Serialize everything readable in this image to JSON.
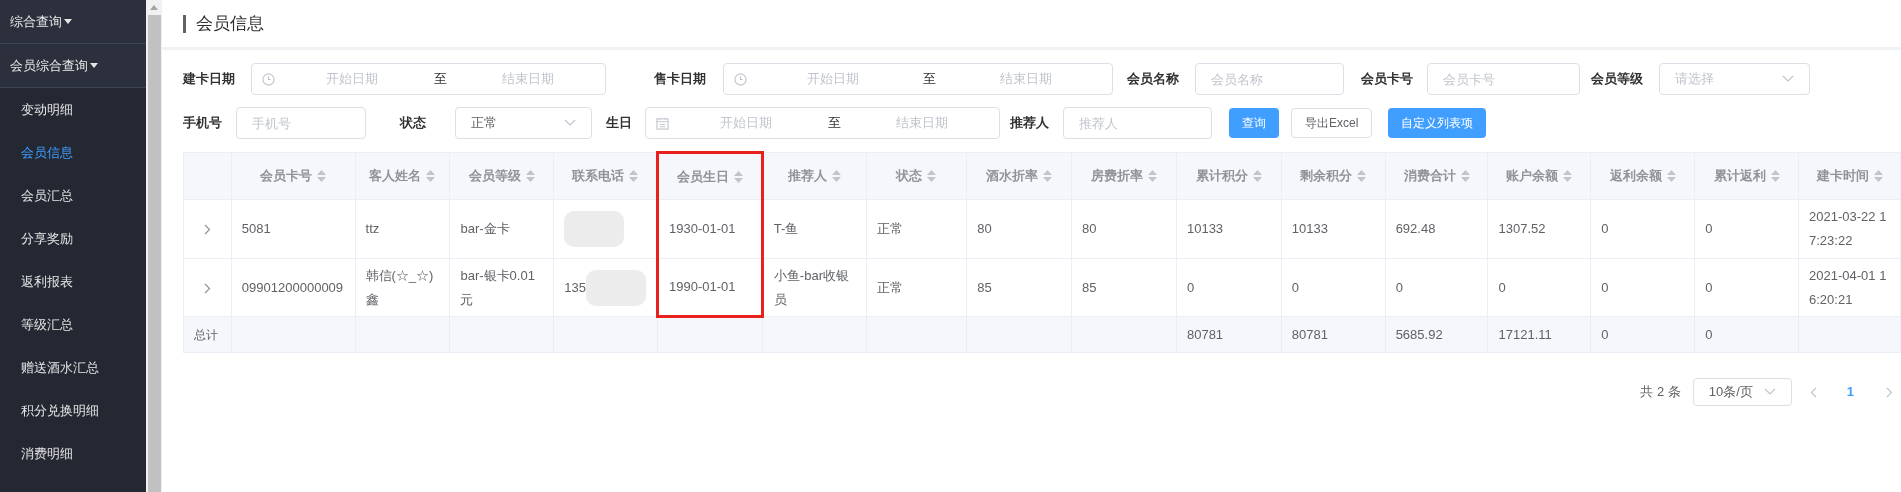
{
  "sidebar": {
    "groups": [
      {
        "label": "综合查询",
        "expanded": true
      },
      {
        "label": "会员综合查询",
        "expanded": true
      }
    ],
    "items": [
      {
        "label": "变动明细",
        "selected": false
      },
      {
        "label": "会员信息",
        "selected": true
      },
      {
        "label": "会员汇总",
        "selected": false
      },
      {
        "label": "分享奖励",
        "selected": false
      },
      {
        "label": "返利报表",
        "selected": false
      },
      {
        "label": "等级汇总",
        "selected": false
      },
      {
        "label": "赠送酒水汇总",
        "selected": false
      },
      {
        "label": "积分兑换明细",
        "selected": false
      },
      {
        "label": "消费明细",
        "selected": false
      }
    ]
  },
  "page_title": "会员信息",
  "filters": [
    [
      {
        "kind": "datetimerange",
        "label": "建卡日期",
        "start_placeholder": "开始日期",
        "separator": "至",
        "end_placeholder": "结束日期"
      },
      {
        "kind": "datetimerange",
        "label": "售卡日期",
        "start_placeholder": "开始日期",
        "separator": "至",
        "end_placeholder": "结束日期"
      },
      {
        "kind": "text",
        "label": "会员名称",
        "placeholder": "会员名称"
      },
      {
        "kind": "text",
        "label": "会员卡号",
        "placeholder": "会员卡号"
      },
      {
        "kind": "select",
        "label": "会员等级",
        "placeholder": "请选择"
      }
    ],
    [
      {
        "kind": "text",
        "label": "手机号",
        "placeholder": "手机号"
      },
      {
        "kind": "select",
        "label": "状态",
        "value": "正常"
      },
      {
        "kind": "daterange",
        "label": "生日",
        "start_placeholder": "开始日期",
        "separator": "至",
        "end_placeholder": "结束日期"
      },
      {
        "kind": "text",
        "label": "推荐人",
        "placeholder": "推荐人"
      }
    ]
  ],
  "buttons": [
    {
      "label": "查询",
      "kind": "primary"
    },
    {
      "label": "导出Excel",
      "kind": "default"
    },
    {
      "label": "自定义列表项",
      "kind": "primary"
    }
  ],
  "table": {
    "columns": [
      {
        "label": "会员卡号",
        "highlighted": false
      },
      {
        "label": "客人姓名",
        "highlighted": false
      },
      {
        "label": "会员等级",
        "highlighted": false
      },
      {
        "label": "联系电话",
        "highlighted": false
      },
      {
        "label": "会员生日",
        "highlighted": true
      },
      {
        "label": "推荐人",
        "highlighted": false
      },
      {
        "label": "状态",
        "highlighted": false
      },
      {
        "label": "酒水折率",
        "highlighted": false
      },
      {
        "label": "房费折率",
        "highlighted": false
      },
      {
        "label": "累计积分",
        "highlighted": false
      },
      {
        "label": "剩余积分",
        "highlighted": false
      },
      {
        "label": "消费合计",
        "highlighted": false
      },
      {
        "label": "账户余额",
        "highlighted": false
      },
      {
        "label": "返利余额",
        "highlighted": false
      },
      {
        "label": "累计返利",
        "highlighted": false
      },
      {
        "label": "建卡时间",
        "highlighted": false
      }
    ],
    "rows": [
      {
        "expanded": false,
        "cells": [
          "5081",
          "ttz",
          "bar-金卡",
          {
            "blurred": true
          },
          "1930-01-01",
          "T-鱼",
          "正常",
          "80",
          "80",
          "10133",
          "10133",
          "692.48",
          "1307.52",
          "0",
          "0",
          "2021-03-22 17:23:22"
        ]
      },
      {
        "expanded": false,
        "cells": [
          "09901200000009",
          "韩信(☆_☆)鑫",
          "bar-银卡0.01元",
          {
            "text": "135",
            "blurred": true
          },
          "1990-01-01",
          "小鱼-bar收银员",
          "正常",
          "85",
          "85",
          "0",
          "0",
          "0",
          "0",
          "0",
          "0",
          "2021-04-01 16:20:21"
        ]
      }
    ],
    "footer": {
      "label": "总计",
      "cells": [
        null,
        null,
        null,
        null,
        null,
        null,
        null,
        null,
        null,
        "80781",
        "80781",
        "5685.92",
        "17121.11",
        "0",
        "0",
        null
      ]
    }
  },
  "pagination": {
    "total": "共 2 条",
    "page_size": "10条/页",
    "pages": [
      {
        "label": "1",
        "selected": true
      }
    ]
  }
}
